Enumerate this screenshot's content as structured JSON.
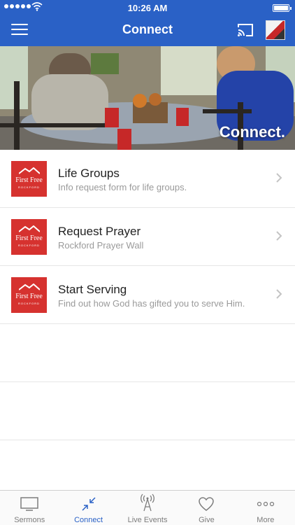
{
  "status_bar": {
    "time": "10:26 AM"
  },
  "header": {
    "title": "Connect"
  },
  "hero": {
    "caption": "Connect."
  },
  "logo": {
    "brand": "First Free",
    "sub": "ROCKFORD"
  },
  "list_items": [
    {
      "title": "Life Groups",
      "subtitle": "Info request form for life groups."
    },
    {
      "title": "Request Prayer",
      "subtitle": "Rockford Prayer Wall"
    },
    {
      "title": "Start Serving",
      "subtitle": "Find out how God has gifted you to serve Him."
    }
  ],
  "tabs": [
    {
      "label": "Sermons",
      "icon": "tv-icon"
    },
    {
      "label": "Connect",
      "icon": "connect-arrows-icon",
      "active": true
    },
    {
      "label": "Live Events",
      "icon": "broadcast-tower-icon"
    },
    {
      "label": "Give",
      "icon": "heart-icon"
    },
    {
      "label": "More",
      "icon": "more-dots-icon"
    }
  ],
  "colors": {
    "accent": "#2a61c6",
    "logo_red": "#d6322f",
    "muted_text": "#9a9a9a"
  }
}
